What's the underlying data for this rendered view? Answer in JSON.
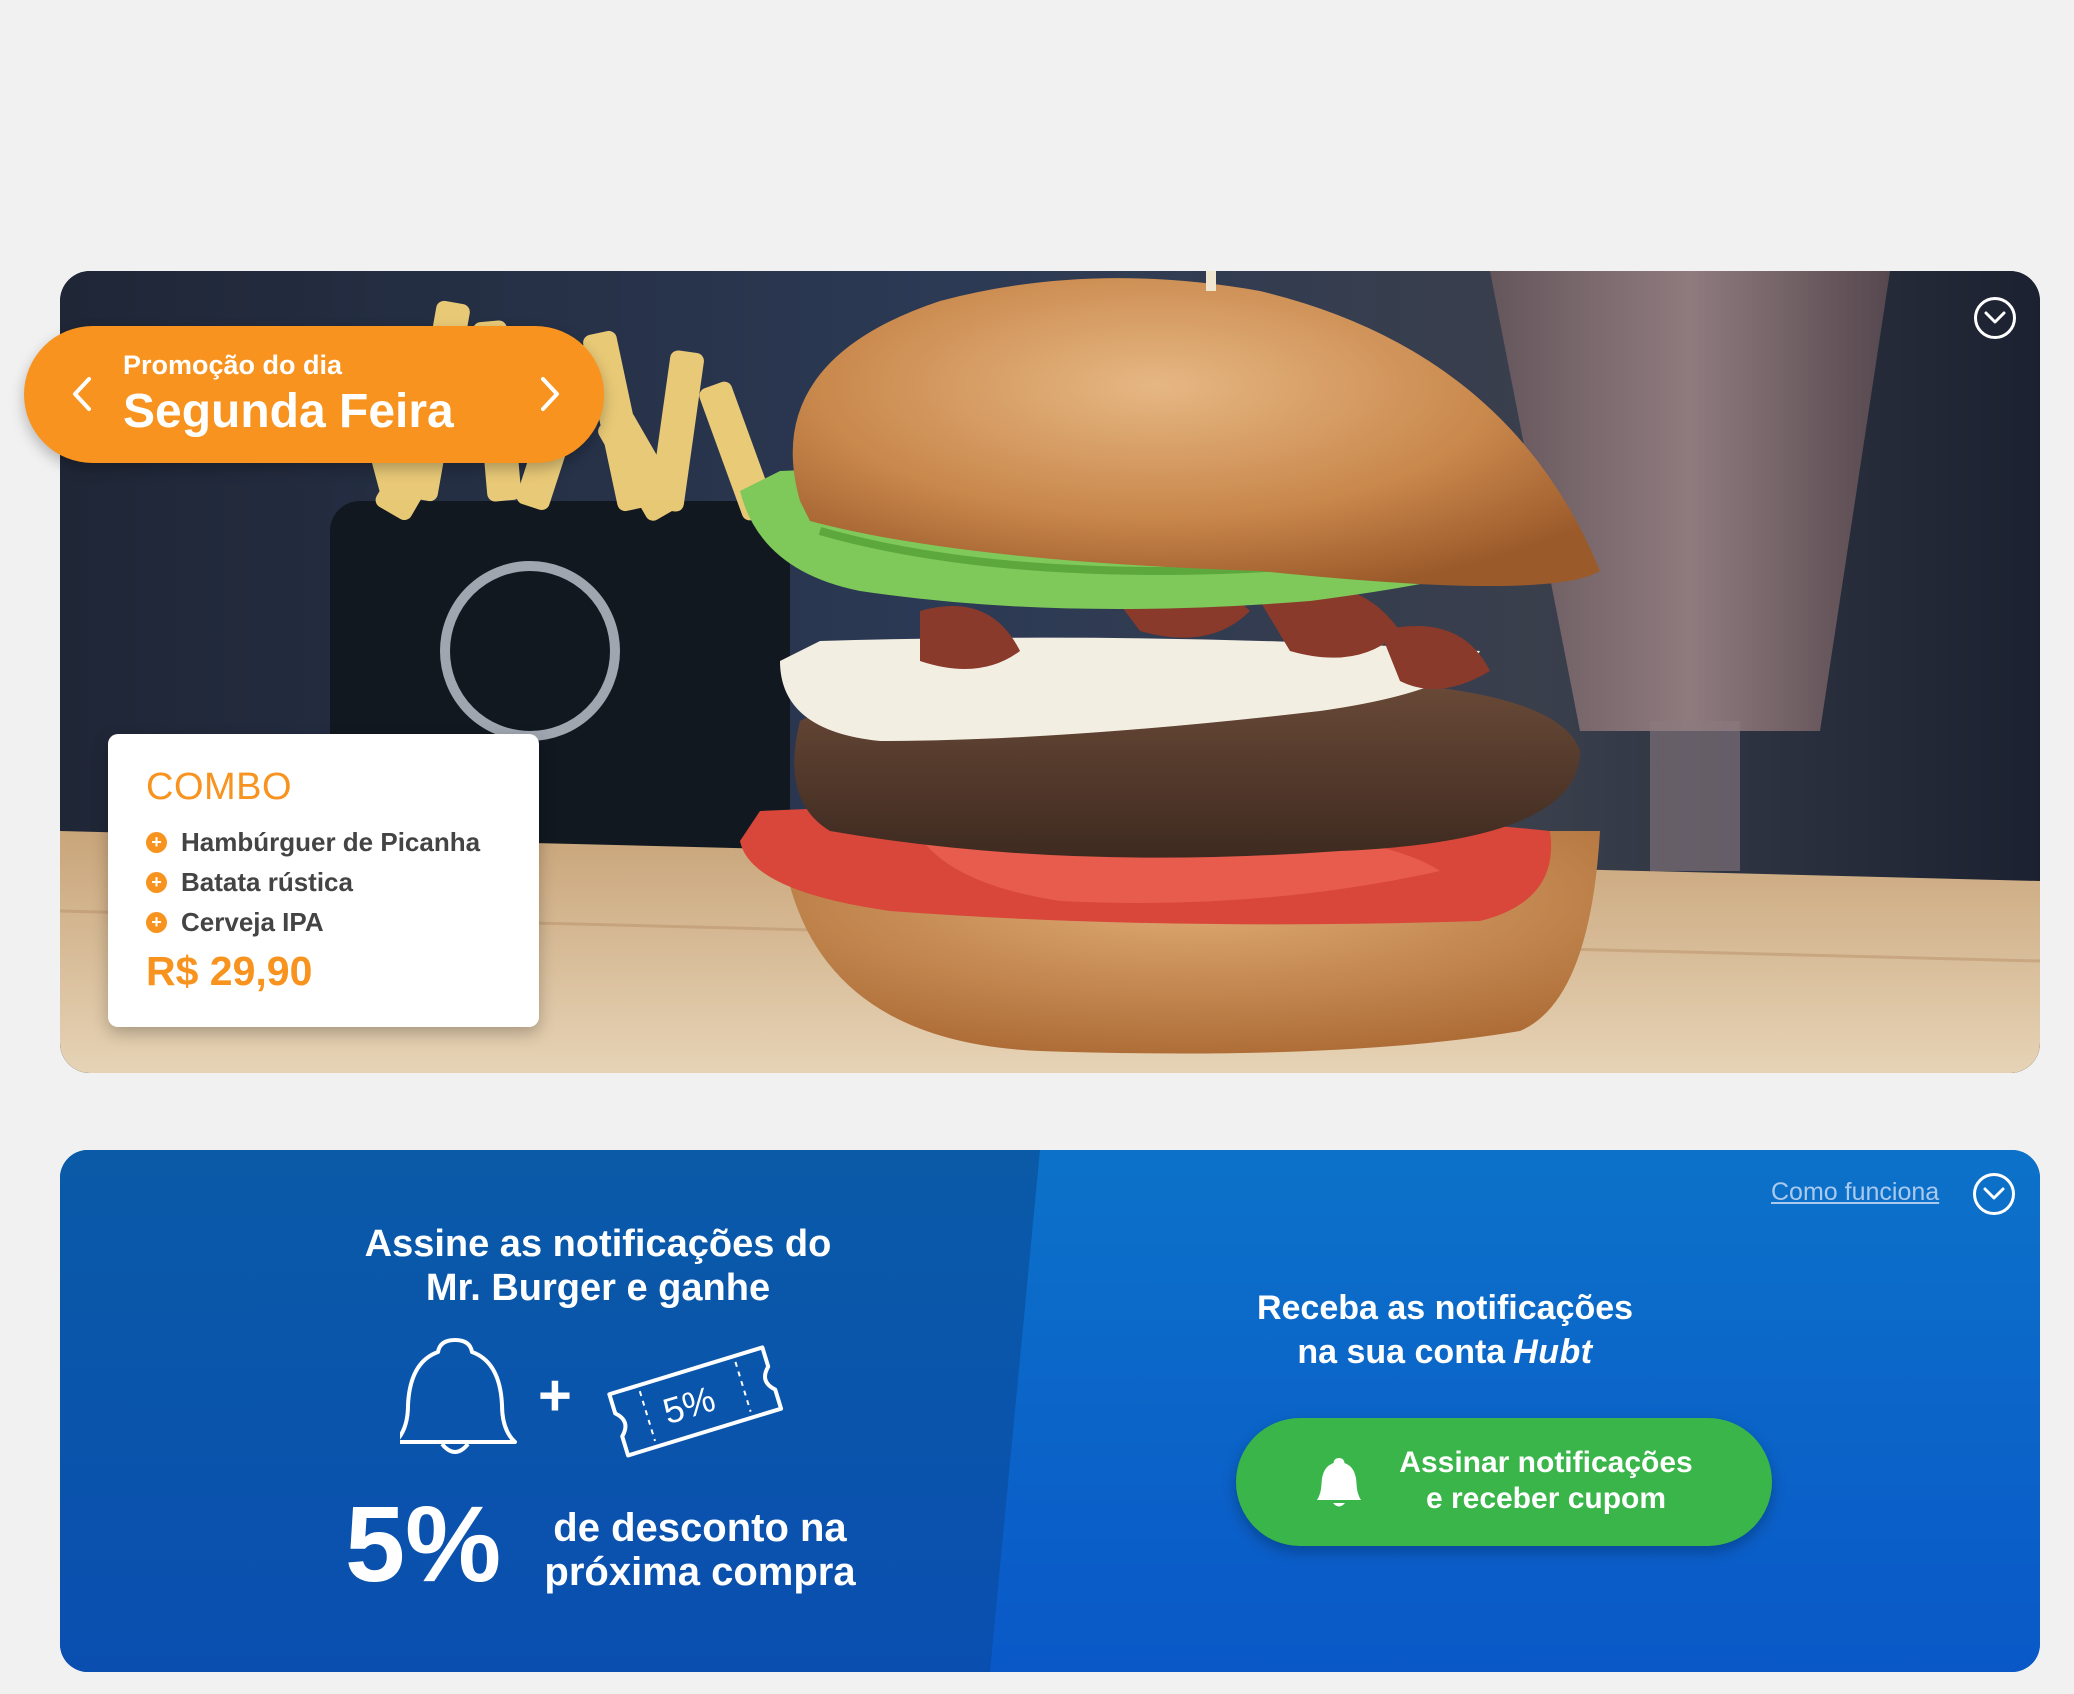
{
  "promo": {
    "subtitle": "Promoção do dia",
    "day": "Segunda Feira",
    "prev_icon": "chevron-left-icon",
    "next_icon": "chevron-right-icon",
    "accent_color": "#f7931e"
  },
  "combo": {
    "title": "COMBO",
    "items": [
      "Hambúrguer de Picanha",
      "Batata rústica",
      "Cerveja IPA"
    ],
    "price": "R$ 29,90",
    "bullet_icon": "plus-circle-icon"
  },
  "hero": {
    "expand_icon": "chevron-down-circle-icon"
  },
  "notify": {
    "title_line1": "Assine as notificações do",
    "title_line2": "Mr. Burger e ganhe",
    "plus_sign": "+",
    "coupon_label": "5%",
    "discount_value": "5%",
    "discount_line1": "de desconto na",
    "discount_line2": "próxima compra",
    "how_it_works": "Como funciona",
    "receive_line1": "Receba as notificações",
    "receive_line2": "na sua conta",
    "brand": "Hubt",
    "button_line1": "Assinar notificações",
    "button_line2": "e receber cupom",
    "panel_color": "#0a5fb8",
    "button_color": "#3ab54a"
  }
}
